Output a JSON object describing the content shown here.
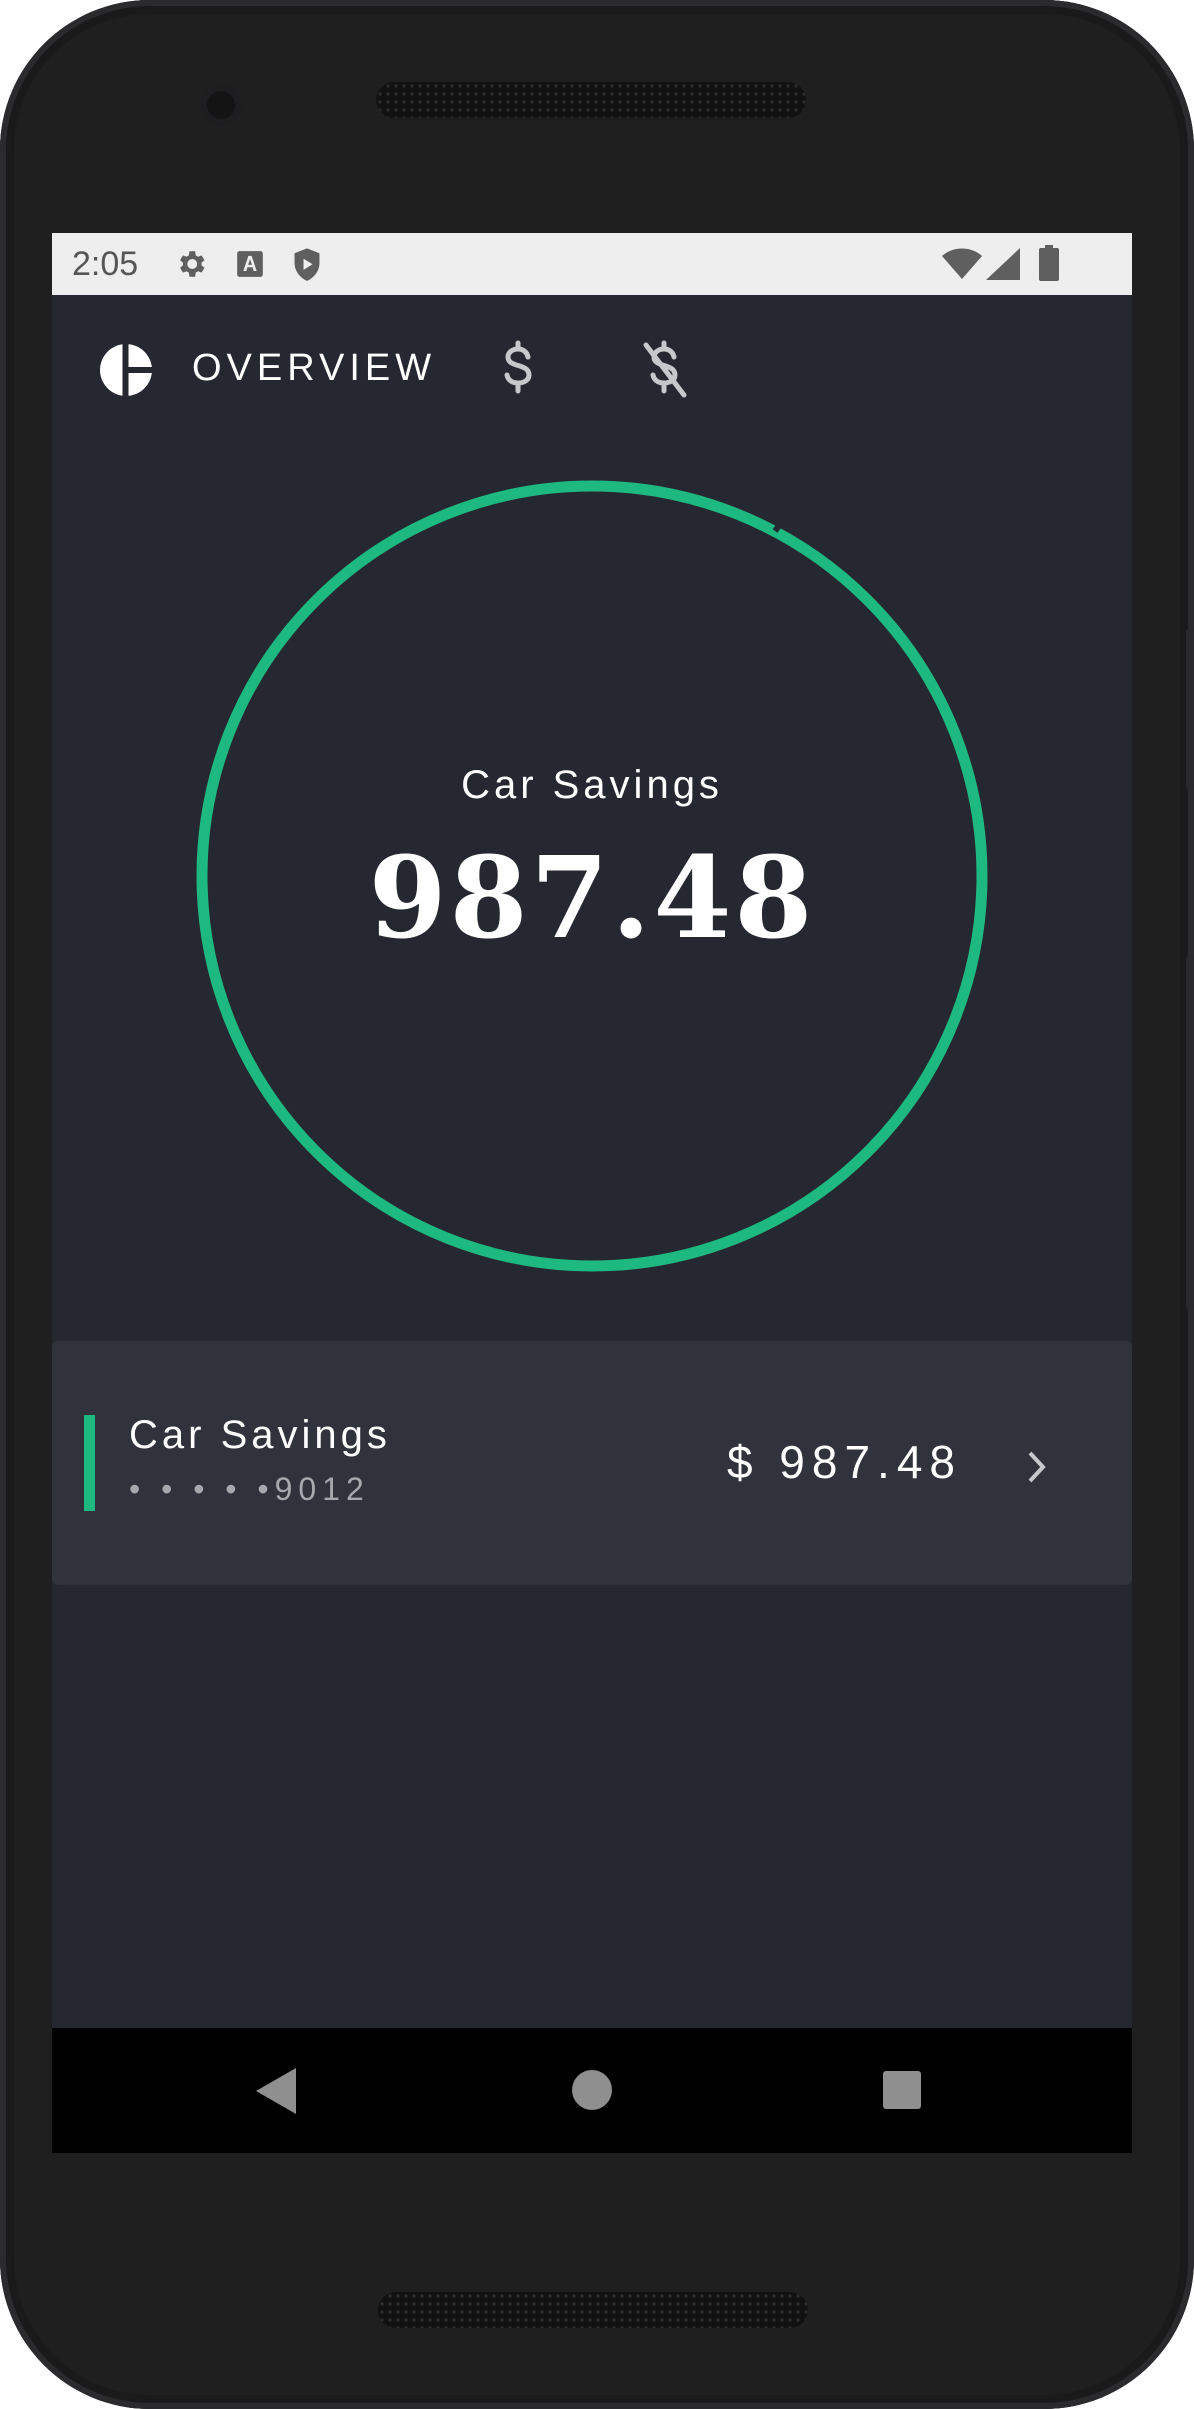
{
  "status_bar": {
    "time": "2:05",
    "icons": [
      "gear-icon",
      "text-a-icon",
      "play-shield-icon",
      "wifi-icon",
      "cellular-signal-icon",
      "battery-icon"
    ]
  },
  "tabs": [
    {
      "name": "overview",
      "label": "OVERVIEW",
      "icon": "pie-chart-icon",
      "selected": true
    },
    {
      "name": "accounts",
      "label": "",
      "icon": "dollar-icon",
      "selected": false
    },
    {
      "name": "bills",
      "label": "",
      "icon": "money-off-icon",
      "selected": false
    }
  ],
  "overview": {
    "title": "Car Savings",
    "total": "987.48",
    "ring_color": "#1eb980"
  },
  "accounts": [
    {
      "name": "Car Savings",
      "number_masked": "• • • • •9012",
      "amount": "$ 987.48",
      "accent_color": "#1eb980"
    }
  ],
  "colors": {
    "background": "#252830",
    "card": "#30333c",
    "accent": "#1eb980",
    "text": "#ffffff",
    "muted": "#a6a8ad"
  },
  "nav_bar": {
    "icons": [
      "back-icon",
      "home-icon",
      "recents-icon"
    ]
  }
}
